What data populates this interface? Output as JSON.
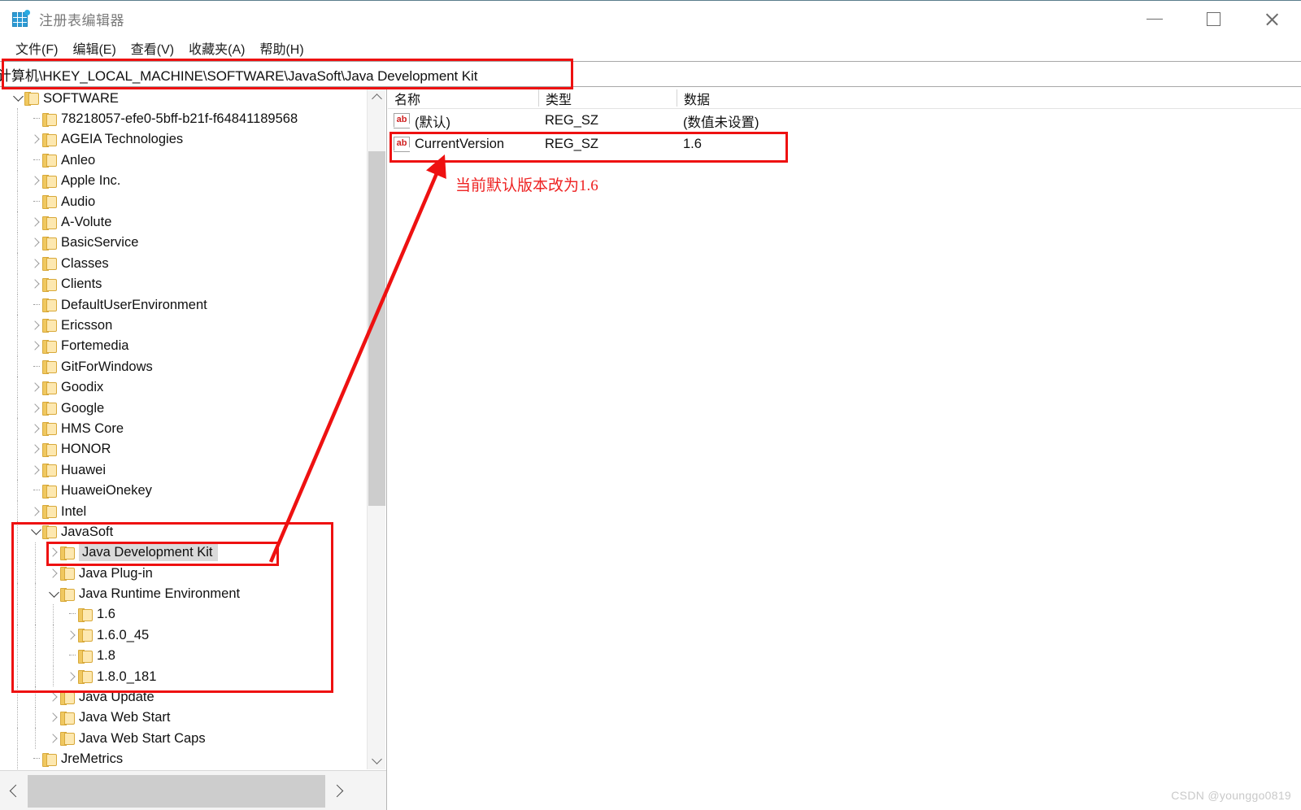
{
  "window": {
    "title": "注册表编辑器",
    "icon": "registry-editor-icon",
    "minimize_label": "—",
    "maximize_label": "□",
    "close_label": "✕"
  },
  "menubar": {
    "items": [
      {
        "label": "文件(F)"
      },
      {
        "label": "编辑(E)"
      },
      {
        "label": "查看(V)"
      },
      {
        "label": "收藏夹(A)"
      },
      {
        "label": "帮助(H)"
      }
    ]
  },
  "address": {
    "value": "计算机\\HKEY_LOCAL_MACHINE\\SOFTWARE\\JavaSoft\\Java Development Kit",
    "placeholder": "计算机\\"
  },
  "tree": {
    "items": [
      {
        "label": "SOFTWARE",
        "depth": 1,
        "state": "open"
      },
      {
        "label": "78218057-efe0-5bff-b21f-f64841189568",
        "depth": 2,
        "state": "leaf"
      },
      {
        "label": "AGEIA Technologies",
        "depth": 2,
        "state": "closed"
      },
      {
        "label": "Anleo",
        "depth": 2,
        "state": "leaf"
      },
      {
        "label": "Apple Inc.",
        "depth": 2,
        "state": "closed"
      },
      {
        "label": "Audio",
        "depth": 2,
        "state": "leaf"
      },
      {
        "label": "A-Volute",
        "depth": 2,
        "state": "closed"
      },
      {
        "label": "BasicService",
        "depth": 2,
        "state": "closed"
      },
      {
        "label": "Classes",
        "depth": 2,
        "state": "closed"
      },
      {
        "label": "Clients",
        "depth": 2,
        "state": "closed"
      },
      {
        "label": "DefaultUserEnvironment",
        "depth": 2,
        "state": "leaf"
      },
      {
        "label": "Ericsson",
        "depth": 2,
        "state": "closed"
      },
      {
        "label": "Fortemedia",
        "depth": 2,
        "state": "closed"
      },
      {
        "label": "GitForWindows",
        "depth": 2,
        "state": "leaf"
      },
      {
        "label": "Goodix",
        "depth": 2,
        "state": "closed"
      },
      {
        "label": "Google",
        "depth": 2,
        "state": "closed"
      },
      {
        "label": "HMS Core",
        "depth": 2,
        "state": "closed"
      },
      {
        "label": "HONOR",
        "depth": 2,
        "state": "closed"
      },
      {
        "label": "Huawei",
        "depth": 2,
        "state": "closed"
      },
      {
        "label": "HuaweiOnekey",
        "depth": 2,
        "state": "leaf"
      },
      {
        "label": "Intel",
        "depth": 2,
        "state": "closed"
      },
      {
        "label": "JavaSoft",
        "depth": 2,
        "state": "open"
      },
      {
        "label": "Java Development Kit",
        "depth": 3,
        "state": "closed",
        "selected": true
      },
      {
        "label": "Java Plug-in",
        "depth": 3,
        "state": "closed"
      },
      {
        "label": "Java Runtime Environment",
        "depth": 3,
        "state": "open"
      },
      {
        "label": "1.6",
        "depth": 4,
        "state": "leaf"
      },
      {
        "label": "1.6.0_45",
        "depth": 4,
        "state": "closed"
      },
      {
        "label": "1.8",
        "depth": 4,
        "state": "leaf"
      },
      {
        "label": "1.8.0_181",
        "depth": 4,
        "state": "closed"
      },
      {
        "label": "Java Update",
        "depth": 3,
        "state": "closed"
      },
      {
        "label": "Java Web Start",
        "depth": 3,
        "state": "closed"
      },
      {
        "label": "Java Web Start Caps",
        "depth": 3,
        "state": "closed"
      },
      {
        "label": "JreMetrics",
        "depth": 2,
        "state": "leaf"
      }
    ]
  },
  "values_list": {
    "columns": [
      {
        "label": "名称"
      },
      {
        "label": "类型"
      },
      {
        "label": "数据"
      }
    ],
    "rows": [
      {
        "icon": "string-value-icon",
        "icon_text": "ab",
        "name": "(默认)",
        "type": "REG_SZ",
        "data": "(数值未设置)"
      },
      {
        "icon": "string-value-icon",
        "icon_text": "ab",
        "name": "CurrentVersion",
        "type": "REG_SZ",
        "data": "1.6"
      }
    ]
  },
  "annotations": {
    "note": "当前默认版本改为1.6",
    "color": "#ee1111"
  },
  "watermark": {
    "text": "CSDN @younggo0819"
  }
}
